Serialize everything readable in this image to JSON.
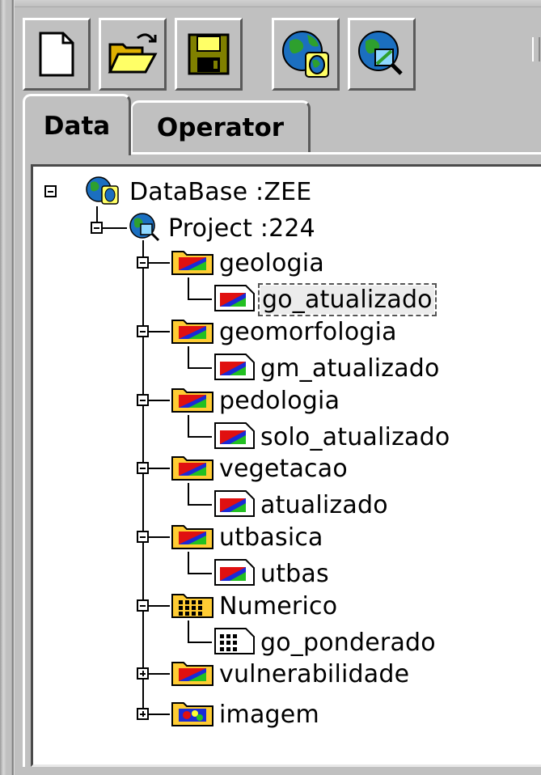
{
  "toolbar": {
    "buttons": [
      {
        "name": "new-file-icon"
      },
      {
        "name": "open-folder-icon"
      },
      {
        "name": "save-disk-icon"
      },
      {
        "name": "database-globe-icon"
      },
      {
        "name": "project-globe-icon"
      }
    ]
  },
  "tabs": [
    {
      "label": "Data",
      "active": true
    },
    {
      "label": "Operator",
      "active": false
    }
  ],
  "tree": {
    "database": "DataBase :ZEE",
    "project": "Project :224",
    "categories": [
      {
        "label": "geologia",
        "type": "thematic",
        "expanded": true,
        "child": "go_atualizado",
        "child_selected": true
      },
      {
        "label": "geomorfologia",
        "type": "thematic",
        "expanded": true,
        "child": "gm_atualizado"
      },
      {
        "label": "pedologia",
        "type": "thematic",
        "expanded": true,
        "child": "solo_atualizado"
      },
      {
        "label": "vegetacao",
        "type": "thematic",
        "expanded": true,
        "child": "atualizado"
      },
      {
        "label": "utbasica",
        "type": "thematic",
        "expanded": true,
        "child": "utbas"
      },
      {
        "label": "Numerico",
        "type": "numeric",
        "expanded": true,
        "child": "go_ponderado"
      },
      {
        "label": "vulnerabilidade",
        "type": "thematic",
        "expanded": false
      },
      {
        "label": "imagem",
        "type": "image",
        "expanded": false
      }
    ]
  }
}
